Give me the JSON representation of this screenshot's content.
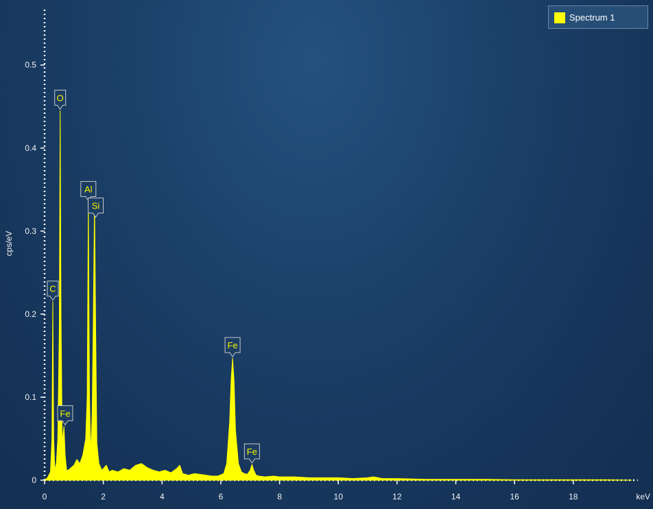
{
  "chart_data": {
    "type": "area",
    "xlabel": "keV",
    "ylabel": "cps/eV",
    "xlim": [
      0,
      20.2
    ],
    "ylim": [
      0,
      0.57
    ],
    "x_ticks": [
      0,
      2,
      4,
      6,
      8,
      10,
      12,
      14,
      16,
      18
    ],
    "x_tick_labels": [
      "0",
      "2",
      "4",
      "6",
      "8",
      "10",
      "12",
      "14",
      "16",
      "18"
    ],
    "y_ticks": [
      0,
      0.1,
      0.2,
      0.3,
      0.4,
      0.5
    ],
    "y_tick_labels": [
      "0",
      "0.1",
      "0.2",
      "0.3",
      "0.4",
      "0.5"
    ],
    "grid": false,
    "legend_position": "top-right",
    "series": [
      {
        "name": "Spectrum 1",
        "color": "#ffff00",
        "x": [
          0.0,
          0.1,
          0.2,
          0.25,
          0.28,
          0.31,
          0.35,
          0.4,
          0.45,
          0.5,
          0.53,
          0.56,
          0.6,
          0.66,
          0.7,
          0.75,
          0.8,
          0.9,
          1.0,
          1.1,
          1.2,
          1.3,
          1.4,
          1.45,
          1.49,
          1.53,
          1.57,
          1.62,
          1.66,
          1.7,
          1.74,
          1.78,
          1.85,
          1.95,
          2.1,
          2.2,
          2.3,
          2.5,
          2.7,
          2.9,
          3.1,
          3.3,
          3.5,
          3.7,
          3.9,
          4.1,
          4.3,
          4.5,
          4.6,
          4.7,
          4.9,
          5.1,
          5.3,
          5.5,
          5.7,
          5.9,
          6.1,
          6.2,
          6.3,
          6.35,
          6.4,
          6.45,
          6.5,
          6.6,
          6.7,
          6.8,
          6.9,
          7.0,
          7.06,
          7.12,
          7.2,
          7.3,
          7.5,
          7.8,
          8.0,
          8.2,
          8.5,
          9.0,
          9.5,
          10.0,
          10.5,
          11.0,
          11.2,
          11.5,
          12.0,
          13.0,
          14.0,
          15.0,
          16.0,
          17.0,
          18.0,
          19.0,
          20.0
        ],
        "values": [
          0.0,
          0.003,
          0.01,
          0.05,
          0.215,
          0.05,
          0.012,
          0.02,
          0.05,
          0.18,
          0.445,
          0.2,
          0.045,
          0.065,
          0.03,
          0.012,
          0.012,
          0.015,
          0.018,
          0.025,
          0.02,
          0.03,
          0.05,
          0.1,
          0.335,
          0.1,
          0.03,
          0.08,
          0.2,
          0.335,
          0.18,
          0.045,
          0.02,
          0.012,
          0.018,
          0.01,
          0.012,
          0.01,
          0.014,
          0.012,
          0.018,
          0.02,
          0.015,
          0.012,
          0.01,
          0.012,
          0.009,
          0.014,
          0.018,
          0.008,
          0.006,
          0.008,
          0.007,
          0.006,
          0.005,
          0.005,
          0.008,
          0.02,
          0.07,
          0.12,
          0.147,
          0.12,
          0.06,
          0.02,
          0.01,
          0.008,
          0.007,
          0.012,
          0.019,
          0.012,
          0.006,
          0.005,
          0.004,
          0.005,
          0.004,
          0.004,
          0.004,
          0.003,
          0.003,
          0.003,
          0.002,
          0.003,
          0.004,
          0.002,
          0.002,
          0.001,
          0.001,
          0.001,
          0.0005,
          0.0005,
          0.0005,
          0.0005,
          0.0
        ]
      }
    ],
    "annotations": [
      {
        "text": "O",
        "x": 0.53,
        "y": 0.445
      },
      {
        "text": "C",
        "x": 0.28,
        "y": 0.215
      },
      {
        "text": "Fe",
        "x": 0.7,
        "y": 0.065
      },
      {
        "text": "Al",
        "x": 1.49,
        "y": 0.335
      },
      {
        "text": "Si",
        "x": 1.74,
        "y": 0.315
      },
      {
        "text": "Fe",
        "x": 6.4,
        "y": 0.147
      },
      {
        "text": "Fe",
        "x": 7.06,
        "y": 0.019
      }
    ]
  }
}
